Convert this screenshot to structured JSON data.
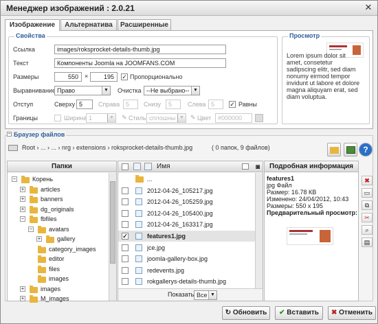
{
  "window": {
    "title": "Менеджер изображений : 2.0.21",
    "close": "✕"
  },
  "tabs": [
    {
      "label": "Изображение",
      "active": true
    },
    {
      "label": "Альтернатива",
      "active": false
    },
    {
      "label": "Расширенные",
      "active": false
    }
  ],
  "properties": {
    "legend": "Свойства",
    "url_label": "Ссылка",
    "url_value": "images/roksprocket-details-thumb.jpg",
    "text_label": "Текст",
    "text_value": "Компоненты Joomla на JOOMFANS.COM",
    "size_label": "Размеры",
    "width": "550",
    "times": "×",
    "height": "195",
    "proportional_label": "Пропорционально",
    "proportional_checked": true,
    "align_label": "Выравнивание",
    "align_value": "Право",
    "clear_label": "Очистка",
    "clear_value": "--Не выбрано--",
    "margin_label": "Отступ",
    "top_label": "Сверху",
    "top_value": "5",
    "right_label": "Справа",
    "right_value": "5",
    "bottom_label": "Снизу",
    "bottom_value": "5",
    "left_label": "Слева",
    "left_value": "5",
    "equal_label": "Равны",
    "equal_checked": true,
    "border_label": "Границы",
    "border_width_label": "Ширина",
    "border_width_value": "1",
    "border_style_label": "Стиль",
    "border_style_value": "сплошны",
    "border_color_label": "Цвет",
    "border_color_value": "#000000"
  },
  "preview": {
    "legend": "Просмотр",
    "text": "Lorem ipsum dolor sit amet, consetetur sadipscing elitr, sed diam nonumy eirmod tempor invidunt ut labore et dolore magna aliquyam erat, sed diam voluptua."
  },
  "browser": {
    "legend": "Браузер файлов",
    "path": "Root › ... › ... › nrg › extensions › roksprocket-details-thumb.jpg",
    "count": "( 0 папок, 9 файлов)",
    "folders_header": "Папки",
    "name_header": "Имя",
    "details_header": "Подробная информация",
    "tree": [
      {
        "label": "Корень",
        "level": 0,
        "toggle": "−"
      },
      {
        "label": "articles",
        "level": 1,
        "toggle": "+"
      },
      {
        "label": "banners",
        "level": 1,
        "toggle": "+"
      },
      {
        "label": "dg_originals",
        "level": 1,
        "toggle": "+"
      },
      {
        "label": "fbfiles",
        "level": 1,
        "toggle": "−"
      },
      {
        "label": "avatars",
        "level": 2,
        "toggle": "−"
      },
      {
        "label": "gallery",
        "level": 3,
        "toggle": "+"
      },
      {
        "label": "category_images",
        "level": 2,
        "toggle": ""
      },
      {
        "label": "editor",
        "level": 2,
        "toggle": ""
      },
      {
        "label": "files",
        "level": 2,
        "toggle": ""
      },
      {
        "label": "images",
        "level": 2,
        "toggle": ""
      },
      {
        "label": "images",
        "level": 1,
        "toggle": "+"
      },
      {
        "label": "M_images",
        "level": 1,
        "toggle": "+"
      }
    ],
    "files": [
      {
        "name": "...",
        "selected": false,
        "up": true
      },
      {
        "name": "2012-04-26_105217.jpg",
        "selected": false
      },
      {
        "name": "2012-04-26_105259.jpg",
        "selected": false
      },
      {
        "name": "2012-04-26_105400.jpg",
        "selected": false
      },
      {
        "name": "2012-04-26_163317.jpg",
        "selected": false
      },
      {
        "name": "features1.jpg",
        "selected": true
      },
      {
        "name": "jce.jpg",
        "selected": false
      },
      {
        "name": "joomla-gallery-box.jpg",
        "selected": false
      },
      {
        "name": "redevents.jpg",
        "selected": false
      },
      {
        "name": "rokgallerys-details-thumb.jpg",
        "selected": false
      }
    ],
    "show_label": "Показать",
    "show_value": "Все",
    "details": {
      "name": "features1",
      "type": "jpg Файл",
      "size": "Размер: 16.78 КB",
      "modified": "Изменено: 24/04/2012, 10:43",
      "dimensions": "Размеры: 550 x 195",
      "preview_label": "Предварительный просмотр:"
    }
  },
  "footer": {
    "refresh": "Обновить",
    "insert": "Вставить",
    "cancel": "Отменить"
  },
  "preview_image_text": "VERSATILE"
}
